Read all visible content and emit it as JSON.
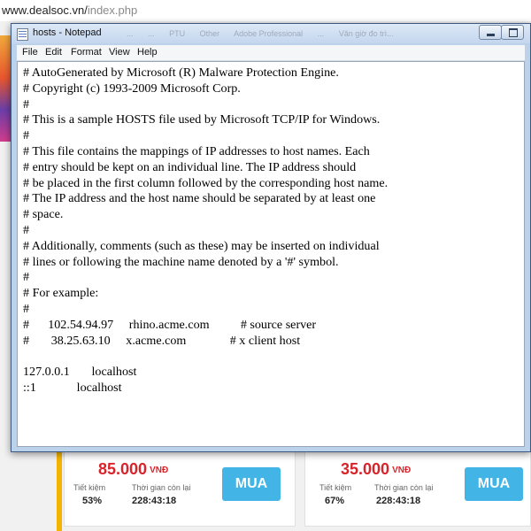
{
  "browser": {
    "url_domain": "www.dealsoc.vn/",
    "url_path": "index.php"
  },
  "window": {
    "title": "hosts - Notepad"
  },
  "taskbar_ghost": [
    "...",
    "...",
    "PTU",
    "Other",
    "Adobe Professional",
    "...",
    "Văn giờ đo trì..."
  ],
  "menu": {
    "file": "File",
    "edit": "Edit",
    "format": "Format",
    "view": "View",
    "help": "Help"
  },
  "document": {
    "text": "# AutoGenerated by Microsoft (R) Malware Protection Engine.\n# Copyright (c) 1993-2009 Microsoft Corp.\n#\n# This is a sample HOSTS file used by Microsoft TCP/IP for Windows.\n#\n# This file contains the mappings of IP addresses to host names. Each\n# entry should be kept on an individual line. The IP address should\n# be placed in the first column followed by the corresponding host name.\n# The IP address and the host name should be separated by at least one\n# space.\n#\n# Additionally, comments (such as these) may be inserted on individual\n# lines or following the machine name denoted by a '#' symbol.\n#\n# For example:\n#\n#      102.54.94.97     rhino.acme.com          # source server\n#       38.25.63.10     x.acme.com              # x client host\n\n127.0.0.1       localhost\n::1             localhost"
  },
  "products": [
    {
      "price": "85.000",
      "currency": "VNĐ",
      "saving_label": "Tiết kiệm",
      "saving_value": "53%",
      "time_label": "Thời gian còn lại",
      "time_value": "228:43:18",
      "buy_label": "MUA"
    },
    {
      "price": "35.000",
      "currency": "VNĐ",
      "saving_label": "Tiết kiệm",
      "saving_value": "67%",
      "time_label": "Thời gian còn lại",
      "time_value": "228:43:18",
      "buy_label": "MUA"
    }
  ],
  "colors": {
    "price": "#d8232a",
    "buy_button": "#42b4e6",
    "accent_stripe": "#f4b400",
    "window_frame": "#bcd1ea"
  }
}
